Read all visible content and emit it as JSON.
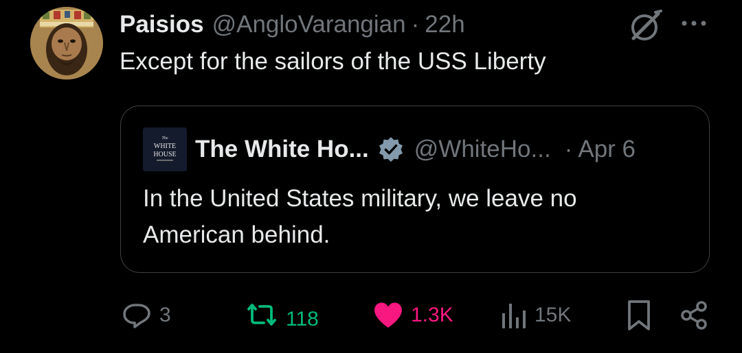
{
  "tweet": {
    "display_name": "Paisios",
    "handle": "@AngloVarangian",
    "separator": "·",
    "time": "22h",
    "text": "Except for the sailors of the USS Liberty"
  },
  "quoted_tweet": {
    "avatar_text": [
      "The",
      "WHITE",
      "HOUSE"
    ],
    "display_name": "The White Ho...",
    "handle": "@WhiteHo...",
    "separator": "·",
    "date": "Apr 6",
    "text": "In the United States military, we leave no American behind."
  },
  "actions": {
    "reply_count": "3",
    "repost_count": "118",
    "like_count": "1.3K",
    "view_count": "15K"
  },
  "colors": {
    "background": "#000000",
    "primary_text": "#e7e9ea",
    "secondary_text": "#71767b",
    "border": "#3e4144",
    "repost_green": "#00ba7c",
    "like_pink": "#f91880",
    "verified_gray": "#829aab"
  },
  "icons": [
    "grok-icon",
    "more-icon",
    "verified-icon",
    "reply-icon",
    "repost-icon",
    "like-icon",
    "views-icon",
    "bookmark-icon",
    "share-icon"
  ]
}
